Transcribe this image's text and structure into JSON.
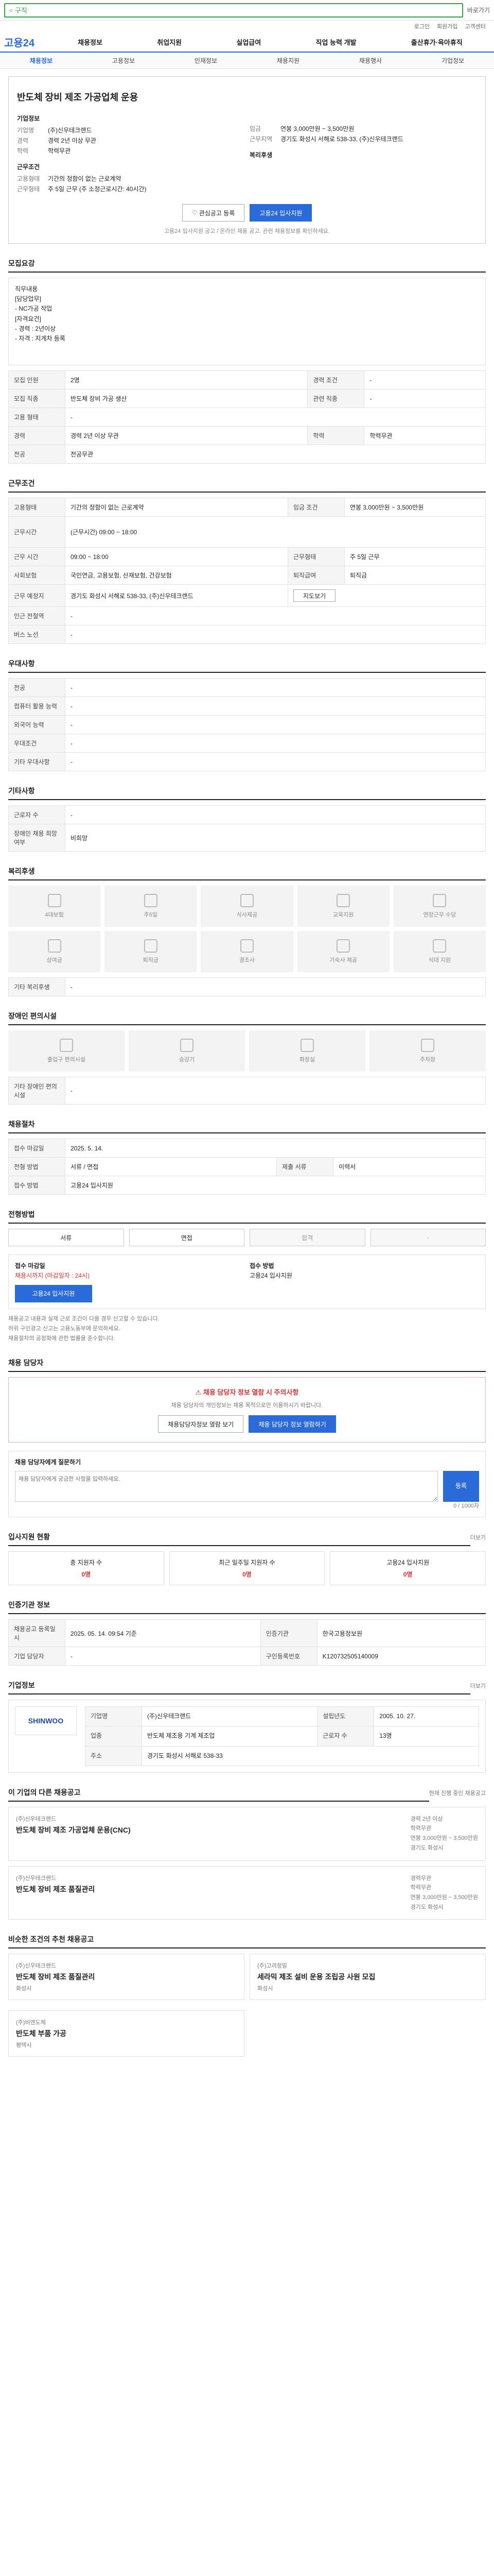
{
  "topbar": {
    "search_value": "구직",
    "shortcut": "바로가기"
  },
  "util": [
    "로그인",
    "회원가입",
    "고객센터"
  ],
  "gnb": {
    "logo": "고용24",
    "menu": [
      "채용정보",
      "취업지원",
      "실업급여",
      "직업 능력 개발",
      "출산휴가·육아휴직"
    ]
  },
  "subnav": [
    "채용정보",
    "고용정보",
    "인재정보",
    "채용지원",
    "채용행사",
    "기업정보"
  ],
  "job": {
    "title": "반도체 장비 제조 가공업체 운용",
    "company_label": "기업정보",
    "company_name": "(주)신우테크랜드",
    "rows_left": [
      [
        "경력",
        "경력 2년 이상 무관"
      ],
      [
        "학력",
        "학력무관"
      ]
    ],
    "rows_right": [
      [
        "임금",
        "연봉 3,000만원 ~ 3,500만원"
      ],
      [
        "근무지역",
        "경기도 화성시 서해로 538-33, (주)신우테크랜드"
      ]
    ],
    "cond_label": "근무조건",
    "cond_rows": [
      [
        "고용형태",
        "기간의 정함이 없는 근로계약"
      ],
      [
        "근무형태",
        "주 5일 근무 (주 소정근로시간: 40시간)"
      ]
    ],
    "welfare_label": "복리후생",
    "save_btn": "관심공고 등록",
    "apply_btn": "고용24 입사지원",
    "note": "고용24 입사지원 공고 / 온라인 채용 공고. 관련 채용정보를 확인하세요."
  },
  "detail": {
    "title": "모집요강",
    "text": [
      "직무내용",
      "[담당업무]",
      "- NC가공 작업",
      "",
      "[자격요건]",
      "- 경력 : 2년이상",
      "- 자격 : 지게차 등록"
    ],
    "table": [
      [
        "모집 인원",
        "2명",
        "경력 조건",
        "-"
      ],
      [
        "모집 직종",
        "반도체 장비 가공 생산",
        "관련 직종",
        "-"
      ],
      [
        "고용 형태",
        "-",
        "",
        ""
      ],
      [
        "경력",
        "경력 2년 이상 무관",
        "학력",
        "학력무관"
      ],
      [
        "전공",
        "전공무관",
        "",
        ""
      ]
    ]
  },
  "conditions": {
    "title": "근무조건",
    "table": [
      [
        "고용형태",
        "기간의 정함이 없는 근로계약",
        "임금 조건",
        "연봉 3,000만원 ~ 3,500만원"
      ],
      [
        "근무시간",
        "(근무시간) 09:00 ~ 18:00",
        "",
        ""
      ],
      [
        "근무 시간",
        "09:00 ~ 18:00",
        "근무형태",
        "주 5일 근무"
      ],
      [
        "사회보험",
        "국민연금, 고용보험, 산재보험, 건강보험",
        "퇴직급여",
        "퇴직금"
      ],
      [
        "근무 예정지",
        "경기도 화성시 서해로 538-33, (주)신우테크랜드",
        "지도보기",
        ""
      ],
      [
        "인근 전철역",
        "-",
        "",
        ""
      ],
      [
        "버스 노선",
        "-",
        "",
        ""
      ]
    ]
  },
  "prefer": {
    "title": "우대사항",
    "rows": [
      [
        "전공",
        "-"
      ],
      [
        "컴퓨터 활용 능력",
        "-"
      ],
      [
        "외국어 능력",
        "-"
      ],
      [
        "우대조건",
        "-"
      ],
      [
        "기타 우대사항",
        "-"
      ]
    ]
  },
  "other": {
    "title": "기타사항",
    "rows": [
      [
        "근로자 수",
        "-"
      ],
      [
        "장애인 채용 희망 여부",
        "비희망"
      ]
    ]
  },
  "welfare": {
    "title": "복리후생",
    "items": [
      "4대보험",
      "주5일",
      "식사제공",
      "교육지원",
      "연장근무 수당",
      "상여금",
      "퇴직금",
      "경조사",
      "기숙사 제공",
      "식대 지원"
    ],
    "other_label": "기타 복리후생",
    "other_value": "-"
  },
  "disability": {
    "title": "장애인 편의시설",
    "items": [
      "출입구 편의시설",
      "승강기",
      "화장실",
      "주차장"
    ],
    "other_label": "기타 장애인 편의시설",
    "other_value": "-"
  },
  "process_info": {
    "title": "채용절차",
    "rows": [
      [
        "접수 마감일",
        "2025. 5. 14.",
        "",
        ""
      ],
      [
        "전형 방법",
        "서류 / 면접",
        "제출 서류",
        "이력서"
      ],
      [
        "접수 방법",
        "고용24 입사지원",
        "",
        ""
      ]
    ]
  },
  "steps": {
    "title": "전형방법",
    "items": [
      "서류",
      "면접",
      "합격",
      "-"
    ]
  },
  "apply_block": {
    "deadline_label": "접수 마감일",
    "deadline_value": "채용시까지 (마감일자 : 24시)",
    "method_label": "접수 방법",
    "method_value": "고용24 입사지원",
    "apply_btn": "고용24 입사지원"
  },
  "notices": [
    "채용공고 내용과 실제 근로 조건이 다를 경우 신고할 수 있습니다.",
    "허위 구인광고 신고는 고용노동부에 문의하세요.",
    "채용절차의 공정화에 관한 법률을 준수합니다."
  ],
  "contact": {
    "title": "채용 담당자",
    "warn": "채용 담당자 정보 열람 시 주의사항",
    "desc": "채용 담당자의 개인정보는 채용 목적으로만 이용하시기 바랍니다.",
    "btn1": "채용담당자정보 열람 보기",
    "btn2": "채용 담당자 정보 열람하기"
  },
  "question": {
    "title": "채용 담당자에게 질문하기",
    "placeholder": "채용 담당자에게 궁금한 사항을 입력하세요.",
    "send": "등록",
    "counter": "0 / 1000자"
  },
  "stats": {
    "title": "입사지원 현황",
    "more": "더보기",
    "items": [
      [
        "총 지원자 수",
        "0명"
      ],
      [
        "최근 일주일 지원자 수",
        "0명"
      ],
      [
        "고용24 입사지원",
        "0명"
      ]
    ]
  },
  "meta": {
    "title": "인증기관 정보",
    "rows": [
      [
        "채용공고 등록일시",
        "2025. 05. 14. 09:54 기준",
        "인증기관",
        "한국고용정보원"
      ],
      [
        "기업 담당자",
        "-",
        "구인등록번호",
        "K120732505140009"
      ]
    ]
  },
  "company": {
    "title": "기업정보",
    "more": "더보기",
    "logo": "SHINWOO",
    "rows": [
      [
        "기업명",
        "(주)신우테크랜드",
        "설립년도",
        "2005. 10. 27."
      ],
      [
        "업종",
        "반도체 제조용 기계 제조업",
        "근로자 수",
        "13명"
      ],
      [
        "주소",
        "경기도 화성시 서해로 538-33",
        "",
        ""
      ]
    ]
  },
  "others": {
    "title": "이 기업의 다른 채용공고",
    "sub": "현재 진행 중인 채용공고",
    "items": [
      {
        "company": "(주)신우테크랜드",
        "title": "반도체 장비 제조 가공업체 운용(CNC)",
        "meta": [
          "경력 2년 이상",
          "학력무관",
          "연봉 3,000만원 ~ 3,500만원",
          "경기도 화성시"
        ]
      },
      {
        "company": "(주)신우테크랜드",
        "title": "반도체 장비 제조 품질관리",
        "meta": [
          "경력무관",
          "학력무관",
          "연봉 3,000만원 ~ 3,500만원",
          "경기도 화성시"
        ]
      }
    ]
  },
  "recommend": {
    "title": "비슷한 조건의 추천 채용공고",
    "items": [
      {
        "company": "(주)신우테크랜드",
        "title": "반도체 장비 제조 품질관리",
        "tag": "화성시"
      },
      {
        "company": "(주)고려정밀",
        "title": "세라믹 제조 설비 운용 조립공 사원 모집",
        "tag": "화성시"
      },
      {
        "company": "(주)비엔도체",
        "title": "반도체 부품 가공",
        "tag": "평택시"
      }
    ]
  }
}
